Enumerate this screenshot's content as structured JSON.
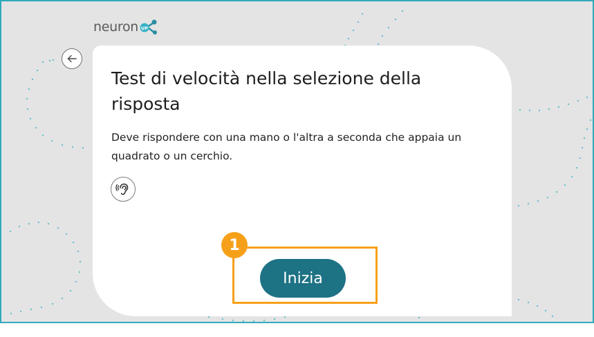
{
  "logo": {
    "text": "neuron",
    "badge_text": "UP"
  },
  "icons": {
    "back": "arrow-left-icon",
    "audio": "ear-icon"
  },
  "card": {
    "title": "Test di velocità nella selezione della risposta",
    "description": "Deve rispondere con una mano o l'altra a seconda che appaia un quadrato o un cerchio.",
    "start_label": "Inizia"
  },
  "annotation": {
    "step_number": "1"
  },
  "colors": {
    "frame_border": "#2fa9bd",
    "button": "#1d7284",
    "highlight": "#f6a01a",
    "background": "#e4e4e4"
  }
}
